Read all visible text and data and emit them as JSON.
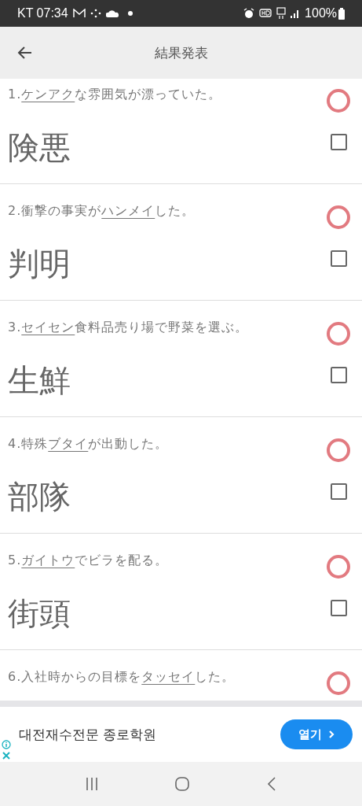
{
  "status_bar": {
    "carrier_time": "KT 07:34",
    "battery": "100%"
  },
  "app_bar": {
    "title": "結果発表"
  },
  "questions": [
    {
      "number": "1.",
      "underlined": "ケンアク",
      "after": "な雰囲気が漂っていた。",
      "answer": "険悪",
      "correct": true,
      "checked": false
    },
    {
      "number": "2.",
      "before": "衝撃の事実が",
      "underlined": "ハンメイ",
      "after": "した。",
      "answer": "判明",
      "correct": true,
      "checked": false
    },
    {
      "number": "3.",
      "underlined": "セイセン",
      "after": "食料品売り場で野菜を選ぶ。",
      "answer": "生鮮",
      "correct": true,
      "checked": false
    },
    {
      "number": "4.",
      "before": "特殊",
      "underlined": "ブタイ",
      "after": "が出動した。",
      "answer": "部隊",
      "correct": true,
      "checked": false
    },
    {
      "number": "5.",
      "underlined": "ガイトウ",
      "after": "でビラを配る。",
      "answer": "街頭",
      "correct": true,
      "checked": false
    },
    {
      "number": "6.",
      "before": "入社時からの目標を",
      "underlined": "タッセイ",
      "after": "した。",
      "correct": true
    }
  ],
  "ad": {
    "title": "대전재수전문 종로학원",
    "button": "열기"
  }
}
